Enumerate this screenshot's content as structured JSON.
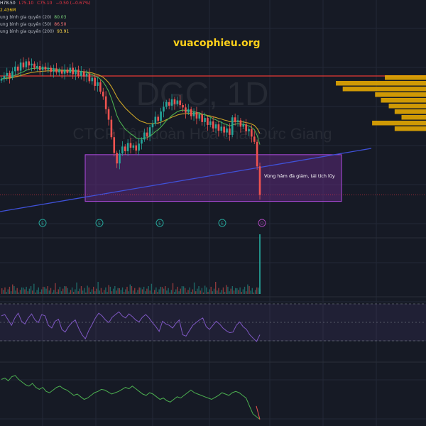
{
  "header": {
    "ohlc": [
      {
        "label": "H",
        "value": "78.50",
        "color": "#e0e3eb"
      },
      {
        "label": "L",
        "value": "75.10",
        "color": "#f23645"
      },
      {
        "label": "C",
        "value": "75.10",
        "color": "#f23645"
      },
      {
        "label": "",
        "value": "−0.50 (−0.67%)",
        "color": "#f23645"
      }
    ],
    "volume": "2.436M",
    "indicators": [
      {
        "label": "ung bình gia quyền (20)",
        "value": "80.03",
        "color": "#7dd87d"
      },
      {
        "label": "ung bình gia quyền (50)",
        "value": "86.50",
        "color": "#ff7777"
      },
      {
        "label": "ung bình gia quyền (200)",
        "value": "93.91",
        "color": "#ffd84a"
      }
    ]
  },
  "watermark": {
    "symbol": "DGC, 1D",
    "company": "CTCP Tập đoàn Hóa chất Đức Giang"
  },
  "brand": "vuacophieu.org",
  "annotation": "Vùng hâm đà giảm, tái tích lũy",
  "event_markers": [
    "E",
    "E",
    "E",
    "E",
    "D"
  ],
  "colors": {
    "background": "#161a25",
    "up": "#26a69a",
    "down": "#ef5350",
    "ema20": "#4caf50",
    "ema50": "#c9a227",
    "resistance": "#e53935",
    "trendline": "#3f51d8",
    "zone_fill": "#5c2a7a",
    "zone_border": "#b04be0",
    "rsi": "#7e57c2",
    "lower": "#4caf50",
    "volume_profile": "#f0b000"
  },
  "chart_data": {
    "type": "candlestick",
    "title": "DGC, 1D",
    "close_series": [
      95,
      95.5,
      96,
      95.2,
      96.3,
      97.1,
      96.4,
      97.8,
      97,
      98,
      97.3,
      97.6,
      96.9,
      97.2,
      96.5,
      97.1,
      96.6,
      96.9,
      96.2,
      96.8,
      96.1,
      96.5,
      95.9,
      96.6,
      96,
      96.9,
      95.8,
      96.6,
      95.5,
      96.3,
      95.4,
      95.9,
      94.6,
      95.2,
      93.8,
      94.4,
      92.8,
      92,
      89.8,
      88,
      85,
      82.3,
      80.5,
      82.2,
      83.4,
      82.6,
      84,
      83.2,
      83.6,
      82.7,
      83.9,
      84.6,
      85.8,
      85.1,
      86.7,
      87.3,
      88.5,
      87.8,
      89.4,
      90.2,
      91,
      90.4,
      91.5,
      90.7,
      91.3,
      90.5,
      90.1,
      89.2,
      89.8,
      88.6,
      89.3,
      88.2,
      88.9,
      87.6,
      88.3,
      87.1,
      87.7,
      86.5,
      87.2,
      86.1,
      86.8,
      85.8,
      86.5,
      85.4,
      88.4,
      87.6,
      87.9,
      86.8,
      87.2,
      86,
      86.4,
      85.1,
      84.2,
      80,
      75.1
    ],
    "indicators": [
      {
        "name": "ung bình gia quyền (20)",
        "last": 80.03
      },
      {
        "name": "ung bình gia quyền (50)",
        "last": 86.5
      },
      {
        "name": "ung bình gia quyền (200)",
        "last": 93.91
      }
    ],
    "resistance_level": 95.5,
    "accumulation_zone": [
      74,
      82
    ],
    "volume_last": "2.436M",
    "volume_profile": [
      0.42,
      0.92,
      0.85,
      0.52,
      0.46,
      0.38,
      0.32,
      0.25,
      0.55,
      0.32
    ],
    "rsi_series": [
      58,
      60,
      52,
      44,
      55,
      62,
      50,
      46,
      55,
      61,
      52,
      48,
      60,
      58,
      44,
      40,
      50,
      53,
      38,
      34,
      42,
      48,
      52,
      40,
      30,
      24,
      36,
      45,
      55,
      62,
      58,
      52,
      48,
      56,
      60,
      64,
      58,
      55,
      61,
      57,
      52,
      49,
      56,
      60,
      55,
      48,
      42,
      35,
      50,
      46,
      44,
      40,
      47,
      52,
      30,
      28,
      36,
      44,
      48,
      52,
      55,
      42,
      38,
      44,
      50,
      46,
      40,
      36,
      33,
      34,
      44,
      49,
      42,
      38,
      30,
      25,
      20,
      30
    ],
    "lower_series": [
      70,
      72,
      68,
      74,
      76,
      70,
      66,
      62,
      60,
      64,
      58,
      55,
      58,
      52,
      50,
      54,
      58,
      60,
      56,
      54,
      50,
      46,
      48,
      44,
      40,
      42,
      46,
      50,
      52,
      55,
      54,
      51,
      48,
      50,
      52,
      55,
      58,
      56,
      60,
      56,
      52,
      48,
      46,
      50,
      48,
      44,
      40,
      42,
      38,
      36,
      40,
      44,
      42,
      46,
      50,
      54,
      50,
      48,
      46,
      44,
      42,
      40,
      43,
      46,
      50,
      48,
      46,
      50,
      52,
      50,
      46,
      42,
      30,
      18,
      14,
      10
    ]
  }
}
